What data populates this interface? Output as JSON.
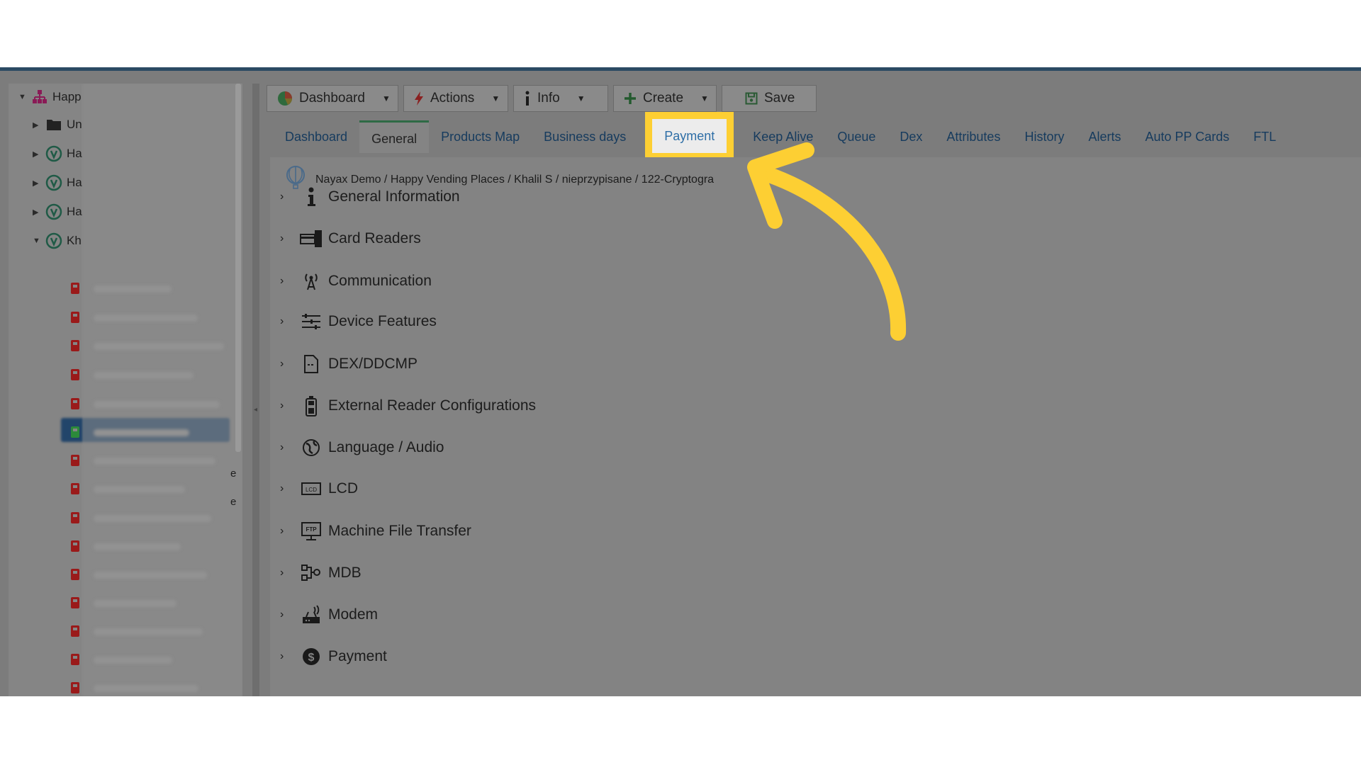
{
  "tree": {
    "nodes": [
      {
        "label": "Happ",
        "icon": "org-chart-icon",
        "expanded": true
      },
      {
        "label": "Un",
        "icon": "folder-icon",
        "expanded": false
      },
      {
        "label": "Ha",
        "icon": "location-pin-icon",
        "expanded": false
      },
      {
        "label": "Ha",
        "icon": "location-pin-icon",
        "expanded": false
      },
      {
        "label": "Ha",
        "icon": "location-pin-icon",
        "expanded": false
      },
      {
        "label": "Kh",
        "icon": "location-pin-icon",
        "expanded": true
      }
    ],
    "child_icons": [
      "vending-machine-icon",
      "fork-knife-icon",
      "infinity-icon",
      "cake-icon",
      "coffee-cup-icon",
      "selected-device-icon",
      "gift-icon",
      "gift-icon",
      "vending-machine-icon",
      "infinity-icon",
      "tap-icon",
      "coffee-cup-icon",
      "phone-icon",
      "candy-icon",
      "coffee-cup-icon"
    ],
    "trailing_chars": [
      "e",
      "e"
    ]
  },
  "toolbar": {
    "dashboard_label": "Dashboard",
    "actions_label": "Actions",
    "info_label": "Info",
    "create_label": "Create",
    "save_label": "Save"
  },
  "tabs": [
    {
      "label": "Dashboard",
      "state": "normal"
    },
    {
      "label": "General",
      "state": "active"
    },
    {
      "label": "Products Map",
      "state": "normal"
    },
    {
      "label": "Business days",
      "state": "normal"
    },
    {
      "label": "Payment",
      "state": "highlight"
    },
    {
      "label": "Keep Alive",
      "state": "normal"
    },
    {
      "label": "Queue",
      "state": "normal"
    },
    {
      "label": "Dex",
      "state": "normal"
    },
    {
      "label": "Attributes",
      "state": "normal"
    },
    {
      "label": "History",
      "state": "normal"
    },
    {
      "label": "Alerts",
      "state": "normal"
    },
    {
      "label": "Auto PP Cards",
      "state": "normal"
    },
    {
      "label": "FTL",
      "state": "normal"
    }
  ],
  "breadcrumb": "Nayax Demo / Happy Vending Places / Khalil S / nieprzypisane / 122-Cryptogra",
  "sections": [
    {
      "label": "General Information",
      "icon": "info-icon"
    },
    {
      "label": "Card Readers",
      "icon": "card-reader-icon"
    },
    {
      "label": "Communication",
      "icon": "antenna-icon"
    },
    {
      "label": "Device Features",
      "icon": "list-settings-icon"
    },
    {
      "label": "DEX/DDCMP",
      "icon": "document-icon"
    },
    {
      "label": "External Reader Configurations",
      "icon": "external-reader-icon"
    },
    {
      "label": "Language / Audio",
      "icon": "globe-audio-icon"
    },
    {
      "label": "LCD",
      "icon": "lcd-icon"
    },
    {
      "label": "Machine File Transfer",
      "icon": "ftp-icon"
    },
    {
      "label": "MDB",
      "icon": "mdb-icon"
    },
    {
      "label": "Modem",
      "icon": "modem-icon"
    },
    {
      "label": "Payment",
      "icon": "dollar-icon"
    }
  ],
  "colors": {
    "overlay": "#7c7c7c",
    "highlight_border": "#fdcf33",
    "arrow": "#fdcf33",
    "tab_text": "#163b5e",
    "top_line": "#2b4a63"
  }
}
